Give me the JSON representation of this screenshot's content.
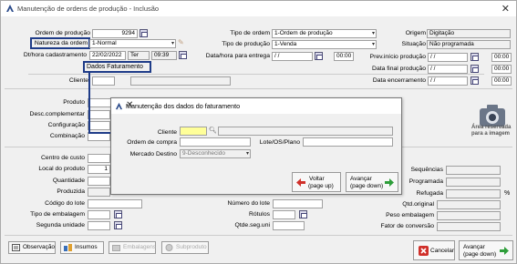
{
  "window": {
    "title": "Manutenção de ordens de produção - Inclusão"
  },
  "header": {
    "ordem_label": "Ordem de produção",
    "ordem_value": "9294",
    "natureza_label": "Natureza da ordem",
    "natureza_value": "1-Normal",
    "dt_label": "Dt/hora cadastramento",
    "dt_date": "22/02/2022",
    "dt_day": "Ter",
    "dt_time": "09:39",
    "faturamento_button": "Dados Faturamento",
    "tipo_ordem_label": "Tipo de ordem",
    "tipo_ordem_value": "1-Ordem de produção",
    "tipo_producao_label": "Tipo de produção",
    "tipo_producao_value": "1-Venda",
    "data_entrega_label": "Data/hora para entrega",
    "data_entrega_value": " / /",
    "hora_entrega_value": "00:00",
    "origem_label": "Origem",
    "origem_value": "Digitação",
    "situacao_label": "Situação",
    "situacao_value": "Não programada",
    "prev_inicio_label": "Prev.início produção",
    "prev_inicio_value": " / /",
    "prev_inicio_hora": "00:00",
    "data_final_label": "Data final produção",
    "data_final_value": " / /",
    "data_final_hora": "00:00",
    "data_encerr_label": "Data encerramento",
    "data_encerr_value": " / /",
    "data_encerr_hora": "00:00",
    "cliente_label": "Cliente"
  },
  "product": {
    "produto_label": "Produto",
    "desc_label": "Desc.complementar",
    "config_label": "Configuração",
    "combinacao_label": "Combinação",
    "image_caption_1": "Área reservada",
    "image_caption_2": "para a imagem"
  },
  "lower": {
    "centro_label": "Centro de custo",
    "local_label": "Local do produto",
    "local_value": "1",
    "quantidade_label": "Quantidade",
    "produzida_label": "Produzida",
    "codigo_lote_label": "Código do lote",
    "tipo_embalagem_label": "Tipo de embalagem",
    "segunda_unidade_label": "Segunda unidade",
    "numero_lote_label": "Número do lote",
    "rotulos_label": "Rótulos",
    "qtde_seg_label": "Qtde.seg.uni",
    "sequencias_label": "Sequências",
    "programada_label": "Programada",
    "refugada_label": "Refugada",
    "percent_sign": "%",
    "qtd_original_label": "Qtd.original",
    "peso_label": "Peso embalagem",
    "fator_label": "Fator de conversão"
  },
  "dialog": {
    "title": "Manutenção dos dados do faturamento",
    "cliente_label": "Cliente",
    "cliente_value": "",
    "ordem_compra_label": "Ordem de compra",
    "lote_label": "Lote/OS/Plano",
    "mercado_label": "Mercado Destino",
    "mercado_value": "9-Desconhecido",
    "voltar_label_1": "Voltar",
    "voltar_label_2": "(page up)",
    "avancar_label_1": "Avançar",
    "avancar_label_2": "(page down)"
  },
  "footer": {
    "tabs": [
      "Observação",
      "Insumos",
      "Embalagens",
      "Subproduto"
    ],
    "cancel_label": "Cancelar",
    "avancar_label_1": "Avançar",
    "avancar_label_2": "(page down)"
  },
  "colors": {
    "highlight": "#1f3c88",
    "yellow_field": "#ffff99",
    "cancel_icon": "#d0302a",
    "next_icon": "#2e9e3a"
  }
}
